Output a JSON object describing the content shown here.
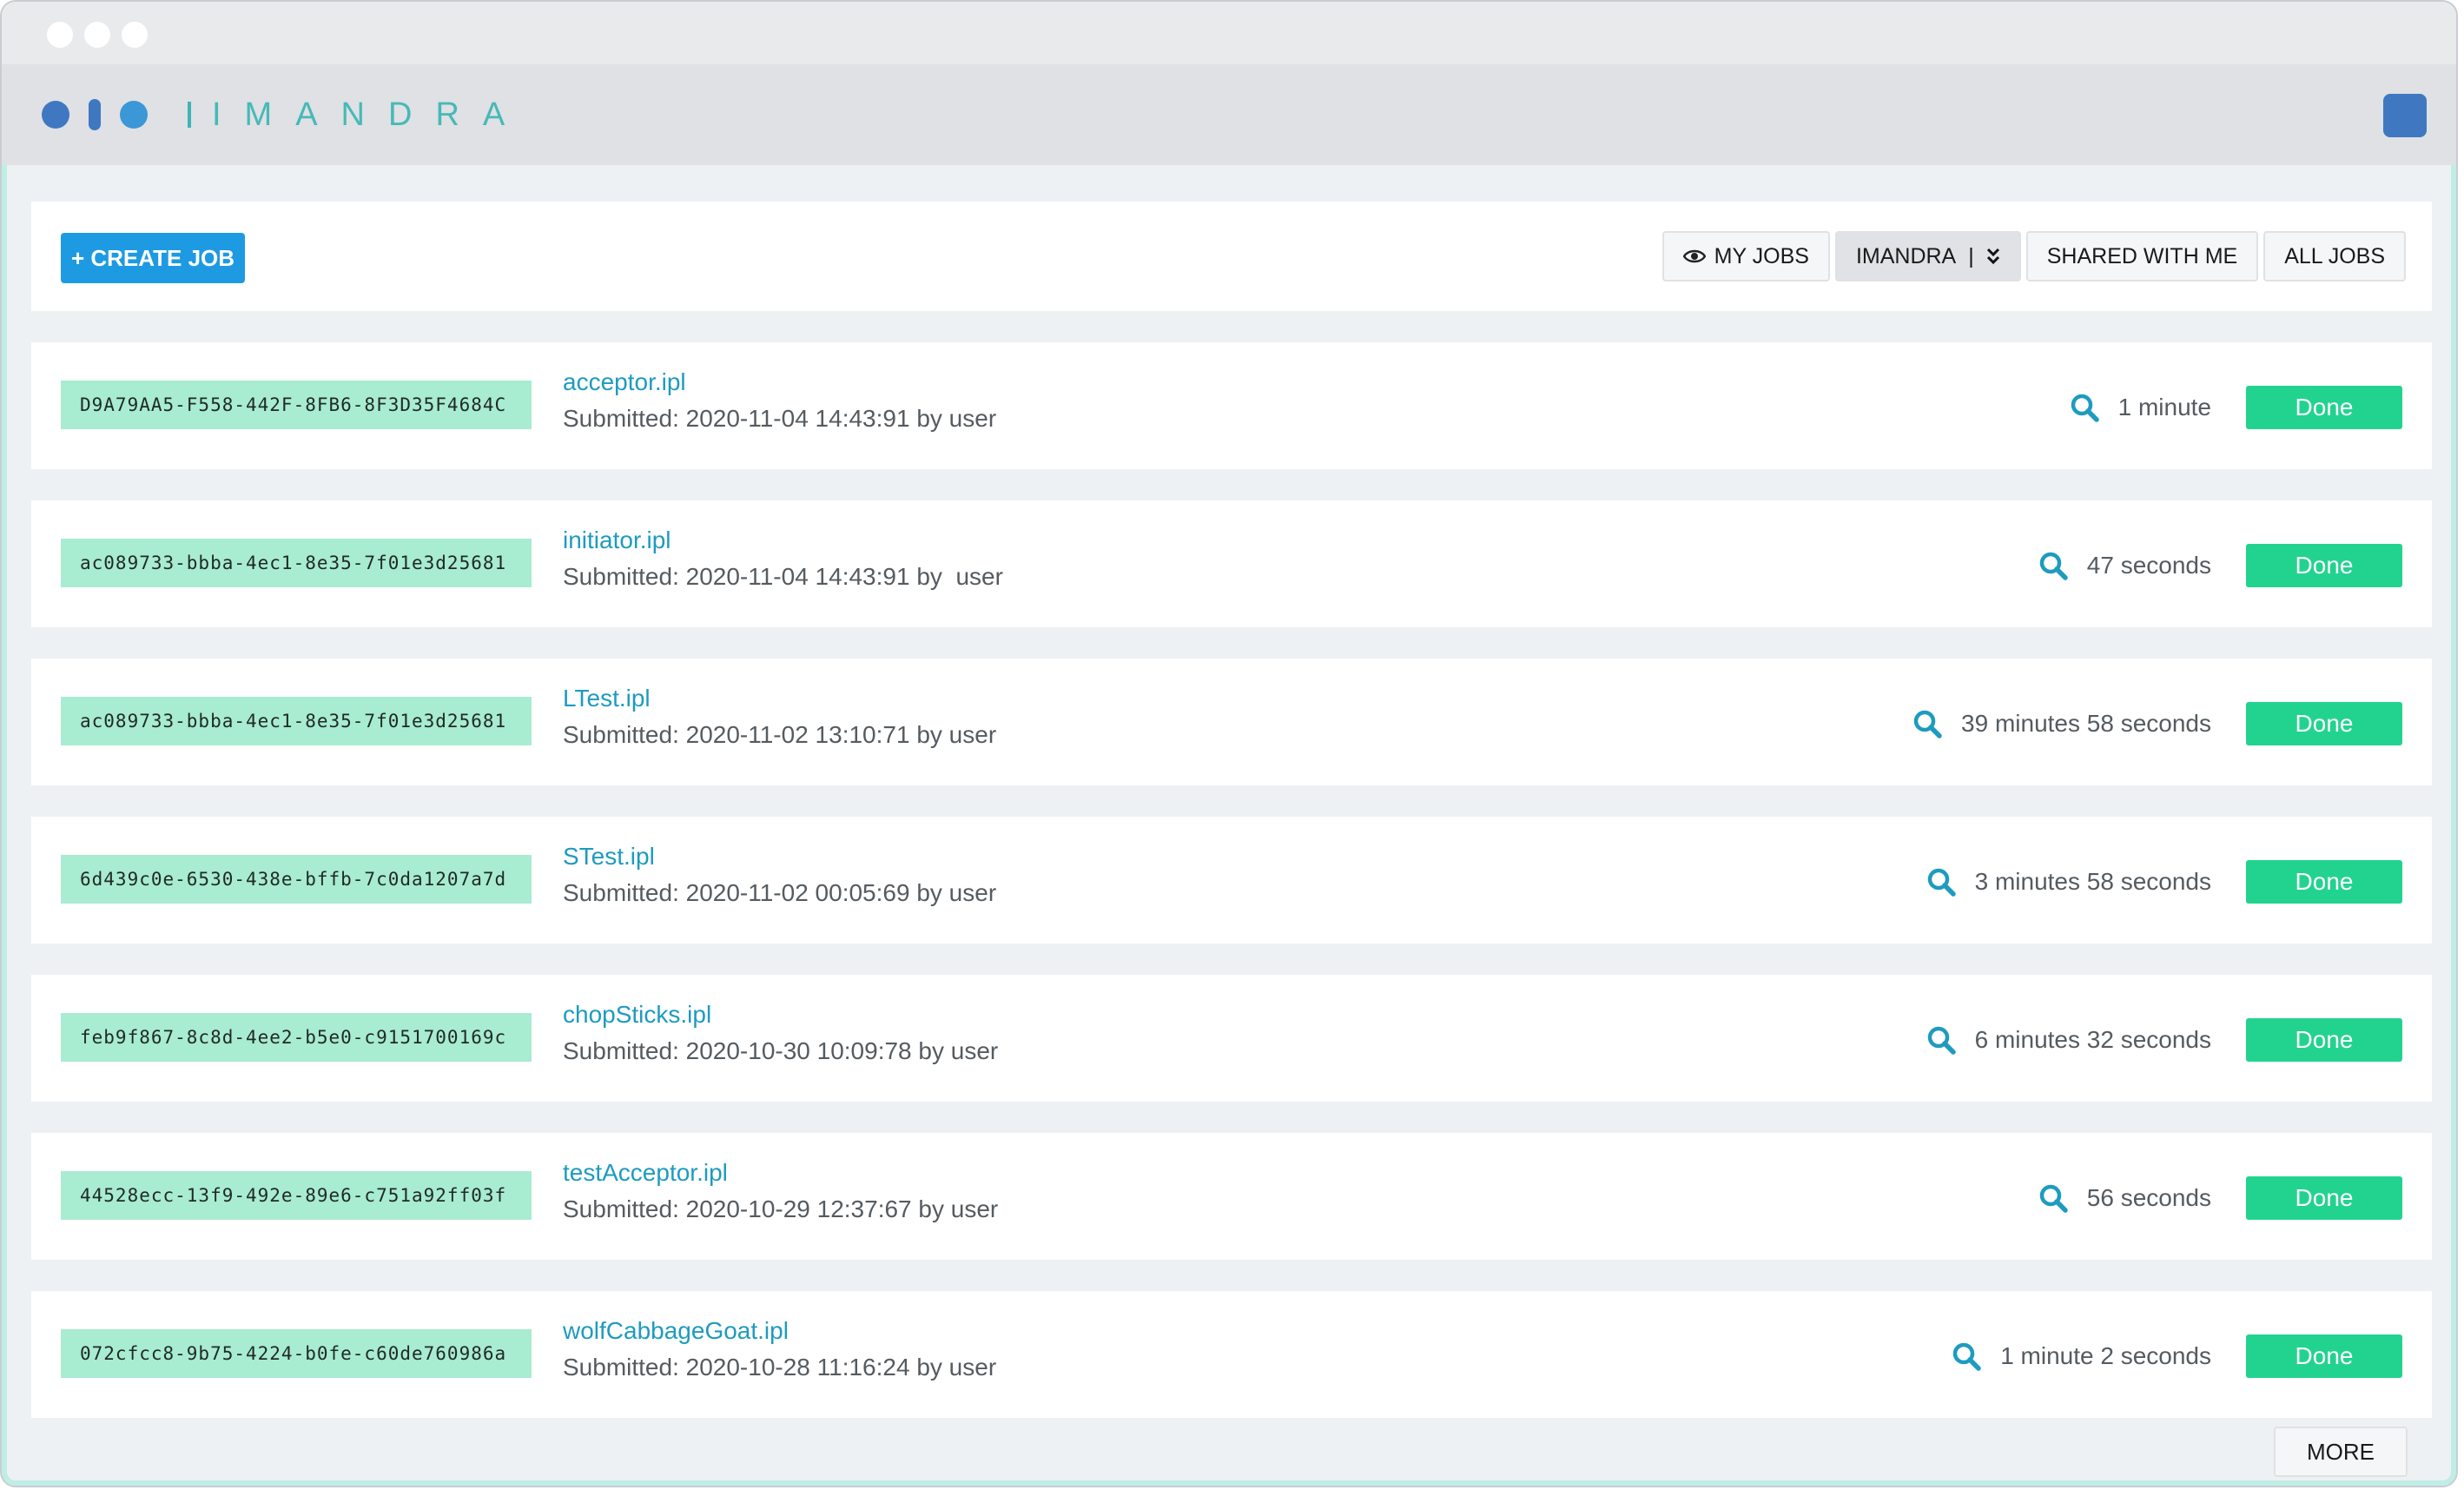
{
  "brand": {
    "name": "IMANDRA"
  },
  "toolbar": {
    "create_label": "+ CREATE JOB",
    "filters": {
      "my_jobs": "MY JOBS",
      "org": "IMANDRA",
      "org_sep": "|",
      "shared": "SHARED WITH ME",
      "all": "ALL JOBS"
    }
  },
  "icons": {
    "eye": "eye-icon",
    "dropdown": "chevron-double-down-icon",
    "search": "search-icon"
  },
  "colors": {
    "primary": "#1e9ae2",
    "done": "#22d38f",
    "uuid_bg": "#a8ecd1",
    "link": "#1e9bbf"
  },
  "jobs": [
    {
      "id": "D9A79AA5-F558-442F-8FB6-8F3D35F4684C",
      "name": "acceptor.ipl",
      "submitted": "Submitted: 2020-11-04 14:43:91 by user",
      "duration": "1 minute",
      "status": "Done"
    },
    {
      "id": "ac089733-bbba-4ec1-8e35-7f01e3d25681",
      "name": "initiator.ipl",
      "submitted": "Submitted: 2020-11-04 14:43:91 by  user",
      "duration": "47 seconds",
      "status": "Done"
    },
    {
      "id": "ac089733-bbba-4ec1-8e35-7f01e3d25681",
      "name": "LTest.ipl",
      "submitted": "Submitted: 2020-11-02 13:10:71 by user",
      "duration": "39 minutes 58 seconds",
      "status": "Done"
    },
    {
      "id": "6d439c0e-6530-438e-bffb-7c0da1207a7d",
      "name": "STest.ipl",
      "submitted": "Submitted: 2020-11-02 00:05:69 by user",
      "duration": "3 minutes 58 seconds",
      "status": "Done"
    },
    {
      "id": "feb9f867-8c8d-4ee2-b5e0-c9151700169c",
      "name": "chopSticks.ipl",
      "submitted": "Submitted: 2020-10-30 10:09:78 by user",
      "duration": "6 minutes 32 seconds",
      "status": "Done"
    },
    {
      "id": "44528ecc-13f9-492e-89e6-c751a92ff03f",
      "name": "testAcceptor.ipl",
      "submitted": "Submitted: 2020-10-29 12:37:67 by user",
      "duration": "56 seconds",
      "status": "Done"
    },
    {
      "id": "072cfcc8-9b75-4224-b0fe-c60de760986a",
      "name": "wolfCabbageGoat.ipl",
      "submitted": "Submitted: 2020-10-28 11:16:24 by user",
      "duration": "1 minute 2 seconds",
      "status": "Done"
    }
  ],
  "footer": {
    "more_label": "MORE"
  }
}
